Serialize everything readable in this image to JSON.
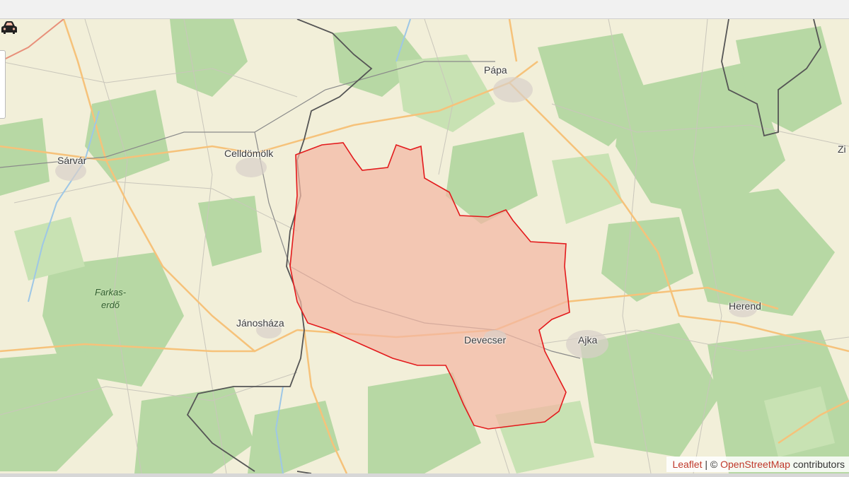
{
  "places": {
    "papa": "Pápa",
    "celldomolk": "Celldömölk",
    "sarvar": "Sárvár",
    "farkaserdo": "Farkas-\nerdő",
    "janoshaza": "Jánosháza",
    "devecser": "Devecser",
    "ajka": "Ajka",
    "herend": "Herend",
    "zi": "Zi"
  },
  "attribution": {
    "leaflet": "Leaflet",
    "sep": " | © ",
    "osm": "OpenStreetMap",
    "contributors": " contributors"
  },
  "marker_icon": "car-icon",
  "colors": {
    "land": "#f2efd9",
    "forest": "#add19e",
    "region_fill": "#f3b7a3",
    "region_stroke": "#e31a1c",
    "roads": "#f9c97a",
    "border": "#444444",
    "attribution_link": "#c0392b"
  }
}
